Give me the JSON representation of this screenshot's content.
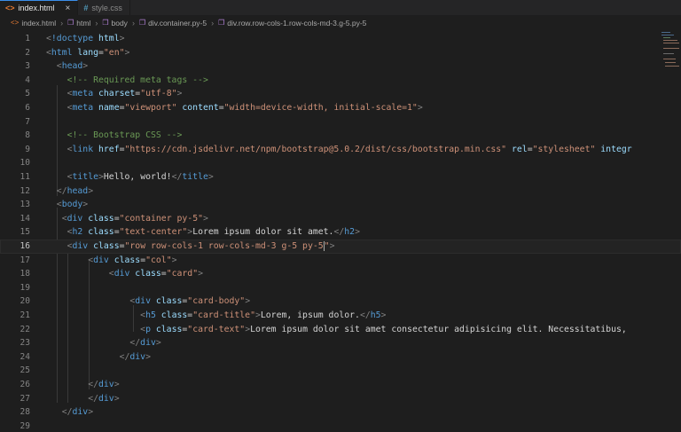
{
  "tabs": [
    {
      "label": "index.html",
      "icon": "html-file-icon",
      "active": true,
      "close": "×"
    },
    {
      "label": "style.css",
      "icon": "css-file-icon",
      "active": false
    }
  ],
  "icons": {
    "html": "<>",
    "css": "#",
    "element": "❒",
    "separator": "›"
  },
  "breadcrumb": [
    "index.html",
    "html",
    "body",
    "div.container.py-5",
    "div.row.row-cols-1.row-cols-md-3.g-5.py-5"
  ],
  "editor": {
    "current_line": 16,
    "lines": [
      {
        "n": "1",
        "parts": [
          [
            "p",
            "<"
          ],
          [
            "t",
            "!doctype"
          ],
          [
            "x",
            " "
          ],
          [
            "a",
            "html"
          ],
          [
            "p",
            ">"
          ]
        ]
      },
      {
        "n": "2",
        "parts": [
          [
            "p",
            "<"
          ],
          [
            "t",
            "html"
          ],
          [
            "x",
            " "
          ],
          [
            "a",
            "lang"
          ],
          [
            "x",
            "="
          ],
          [
            "s",
            "\"en\""
          ],
          [
            "p",
            ">"
          ]
        ]
      },
      {
        "n": "3",
        "parts": [
          [
            "x",
            "  "
          ],
          [
            "p",
            "<"
          ],
          [
            "t",
            "head"
          ],
          [
            "p",
            ">"
          ]
        ]
      },
      {
        "n": "4",
        "parts": [
          [
            "x",
            "    "
          ],
          [
            "c",
            "<!-- Required meta tags -->"
          ]
        ]
      },
      {
        "n": "5",
        "parts": [
          [
            "x",
            "    "
          ],
          [
            "p",
            "<"
          ],
          [
            "t",
            "meta"
          ],
          [
            "x",
            " "
          ],
          [
            "a",
            "charset"
          ],
          [
            "x",
            "="
          ],
          [
            "s",
            "\"utf-8\""
          ],
          [
            "p",
            ">"
          ]
        ]
      },
      {
        "n": "6",
        "parts": [
          [
            "x",
            "    "
          ],
          [
            "p",
            "<"
          ],
          [
            "t",
            "meta"
          ],
          [
            "x",
            " "
          ],
          [
            "a",
            "name"
          ],
          [
            "x",
            "="
          ],
          [
            "s",
            "\"viewport\""
          ],
          [
            "x",
            " "
          ],
          [
            "a",
            "content"
          ],
          [
            "x",
            "="
          ],
          [
            "s",
            "\"width=device-width, initial-scale=1\""
          ],
          [
            "p",
            ">"
          ]
        ]
      },
      {
        "n": "7",
        "parts": []
      },
      {
        "n": "8",
        "parts": [
          [
            "x",
            "    "
          ],
          [
            "c",
            "<!-- Bootstrap CSS -->"
          ]
        ]
      },
      {
        "n": "9",
        "parts": [
          [
            "x",
            "    "
          ],
          [
            "p",
            "<"
          ],
          [
            "t",
            "link"
          ],
          [
            "x",
            " "
          ],
          [
            "a",
            "href"
          ],
          [
            "x",
            "="
          ],
          [
            "s",
            "\"https://cdn.jsdelivr.net/npm/bootstrap@5.0.2/dist/css/bootstrap.min.css\""
          ],
          [
            "x",
            " "
          ],
          [
            "a",
            "rel"
          ],
          [
            "x",
            "="
          ],
          [
            "s",
            "\"stylesheet\""
          ],
          [
            "x",
            " "
          ],
          [
            "a",
            "integr"
          ]
        ]
      },
      {
        "n": "10",
        "parts": []
      },
      {
        "n": "11",
        "parts": [
          [
            "x",
            "    "
          ],
          [
            "p",
            "<"
          ],
          [
            "t",
            "title"
          ],
          [
            "p",
            ">"
          ],
          [
            "x",
            "Hello, world!"
          ],
          [
            "p",
            "</"
          ],
          [
            "t",
            "title"
          ],
          [
            "p",
            ">"
          ]
        ]
      },
      {
        "n": "12",
        "parts": [
          [
            "x",
            "  "
          ],
          [
            "p",
            "</"
          ],
          [
            "t",
            "head"
          ],
          [
            "p",
            ">"
          ]
        ]
      },
      {
        "n": "13",
        "parts": [
          [
            "x",
            "  "
          ],
          [
            "p",
            "<"
          ],
          [
            "t",
            "body"
          ],
          [
            "p",
            ">"
          ]
        ]
      },
      {
        "n": "14",
        "parts": [
          [
            "x",
            "   "
          ],
          [
            "p",
            "<"
          ],
          [
            "t",
            "div"
          ],
          [
            "x",
            " "
          ],
          [
            "a",
            "class"
          ],
          [
            "x",
            "="
          ],
          [
            "s",
            "\"container py-5\""
          ],
          [
            "p",
            ">"
          ]
        ]
      },
      {
        "n": "15",
        "parts": [
          [
            "x",
            "    "
          ],
          [
            "p",
            "<"
          ],
          [
            "t",
            "h2"
          ],
          [
            "x",
            " "
          ],
          [
            "a",
            "class"
          ],
          [
            "x",
            "="
          ],
          [
            "s",
            "\"text-center\""
          ],
          [
            "p",
            ">"
          ],
          [
            "x",
            "Lorem ipsum dolor sit amet."
          ],
          [
            "p",
            "</"
          ],
          [
            "t",
            "h2"
          ],
          [
            "p",
            ">"
          ]
        ]
      },
      {
        "n": "16",
        "parts": [
          [
            "x",
            "    "
          ],
          [
            "p",
            "<"
          ],
          [
            "t",
            "div"
          ],
          [
            "x",
            " "
          ],
          [
            "a",
            "class"
          ],
          [
            "x",
            "="
          ],
          [
            "s",
            "\"row row-cols-1 row-cols-md-3 g-5 py-5"
          ],
          [
            "cursor",
            ""
          ],
          [
            "s",
            "\""
          ],
          [
            "p",
            ">"
          ]
        ]
      },
      {
        "n": "17",
        "parts": [
          [
            "x",
            "        "
          ],
          [
            "p",
            "<"
          ],
          [
            "t",
            "div"
          ],
          [
            "x",
            " "
          ],
          [
            "a",
            "class"
          ],
          [
            "x",
            "="
          ],
          [
            "s",
            "\"col\""
          ],
          [
            "p",
            ">"
          ]
        ]
      },
      {
        "n": "18",
        "parts": [
          [
            "x",
            "            "
          ],
          [
            "p",
            "<"
          ],
          [
            "t",
            "div"
          ],
          [
            "x",
            " "
          ],
          [
            "a",
            "class"
          ],
          [
            "x",
            "="
          ],
          [
            "s",
            "\"card\""
          ],
          [
            "p",
            ">"
          ]
        ]
      },
      {
        "n": "19",
        "parts": []
      },
      {
        "n": "20",
        "parts": [
          [
            "x",
            "                "
          ],
          [
            "p",
            "<"
          ],
          [
            "t",
            "div"
          ],
          [
            "x",
            " "
          ],
          [
            "a",
            "class"
          ],
          [
            "x",
            "="
          ],
          [
            "s",
            "\"card-body\""
          ],
          [
            "p",
            ">"
          ]
        ]
      },
      {
        "n": "21",
        "parts": [
          [
            "x",
            "                  "
          ],
          [
            "p",
            "<"
          ],
          [
            "t",
            "h5"
          ],
          [
            "x",
            " "
          ],
          [
            "a",
            "class"
          ],
          [
            "x",
            "="
          ],
          [
            "s",
            "\"card-title\""
          ],
          [
            "p",
            ">"
          ],
          [
            "x",
            "Lorem, ipsum dolor."
          ],
          [
            "p",
            "</"
          ],
          [
            "t",
            "h5"
          ],
          [
            "p",
            ">"
          ]
        ]
      },
      {
        "n": "22",
        "parts": [
          [
            "x",
            "                  "
          ],
          [
            "p",
            "<"
          ],
          [
            "t",
            "p"
          ],
          [
            "x",
            " "
          ],
          [
            "a",
            "class"
          ],
          [
            "x",
            "="
          ],
          [
            "s",
            "\"card-text\""
          ],
          [
            "p",
            ">"
          ],
          [
            "x",
            "Lorem ipsum dolor sit amet consectetur adipisicing elit. Necessitatibus,"
          ]
        ]
      },
      {
        "n": "23",
        "parts": [
          [
            "x",
            "                "
          ],
          [
            "p",
            "</"
          ],
          [
            "t",
            "div"
          ],
          [
            "p",
            ">"
          ]
        ]
      },
      {
        "n": "24",
        "parts": [
          [
            "x",
            "              "
          ],
          [
            "p",
            "</"
          ],
          [
            "t",
            "div"
          ],
          [
            "p",
            ">"
          ]
        ]
      },
      {
        "n": "25",
        "parts": []
      },
      {
        "n": "26",
        "parts": [
          [
            "x",
            "        "
          ],
          [
            "p",
            "</"
          ],
          [
            "t",
            "div"
          ],
          [
            "p",
            ">"
          ]
        ]
      },
      {
        "n": "27",
        "parts": [
          [
            "x",
            "        "
          ],
          [
            "p",
            "</"
          ],
          [
            "t",
            "div"
          ],
          [
            "p",
            ">"
          ]
        ]
      },
      {
        "n": "28",
        "parts": [
          [
            "x",
            "   "
          ],
          [
            "p",
            "</"
          ],
          [
            "t",
            "div"
          ],
          [
            "p",
            ">"
          ]
        ]
      },
      {
        "n": "29",
        "parts": []
      }
    ]
  },
  "colors": {
    "background": "#1e1e1e",
    "tag": "#569cd6",
    "attribute": "#9cdcfe",
    "string": "#ce9178",
    "comment": "#6a9955",
    "punctuation": "#808080",
    "text": "#d4d4d4"
  }
}
